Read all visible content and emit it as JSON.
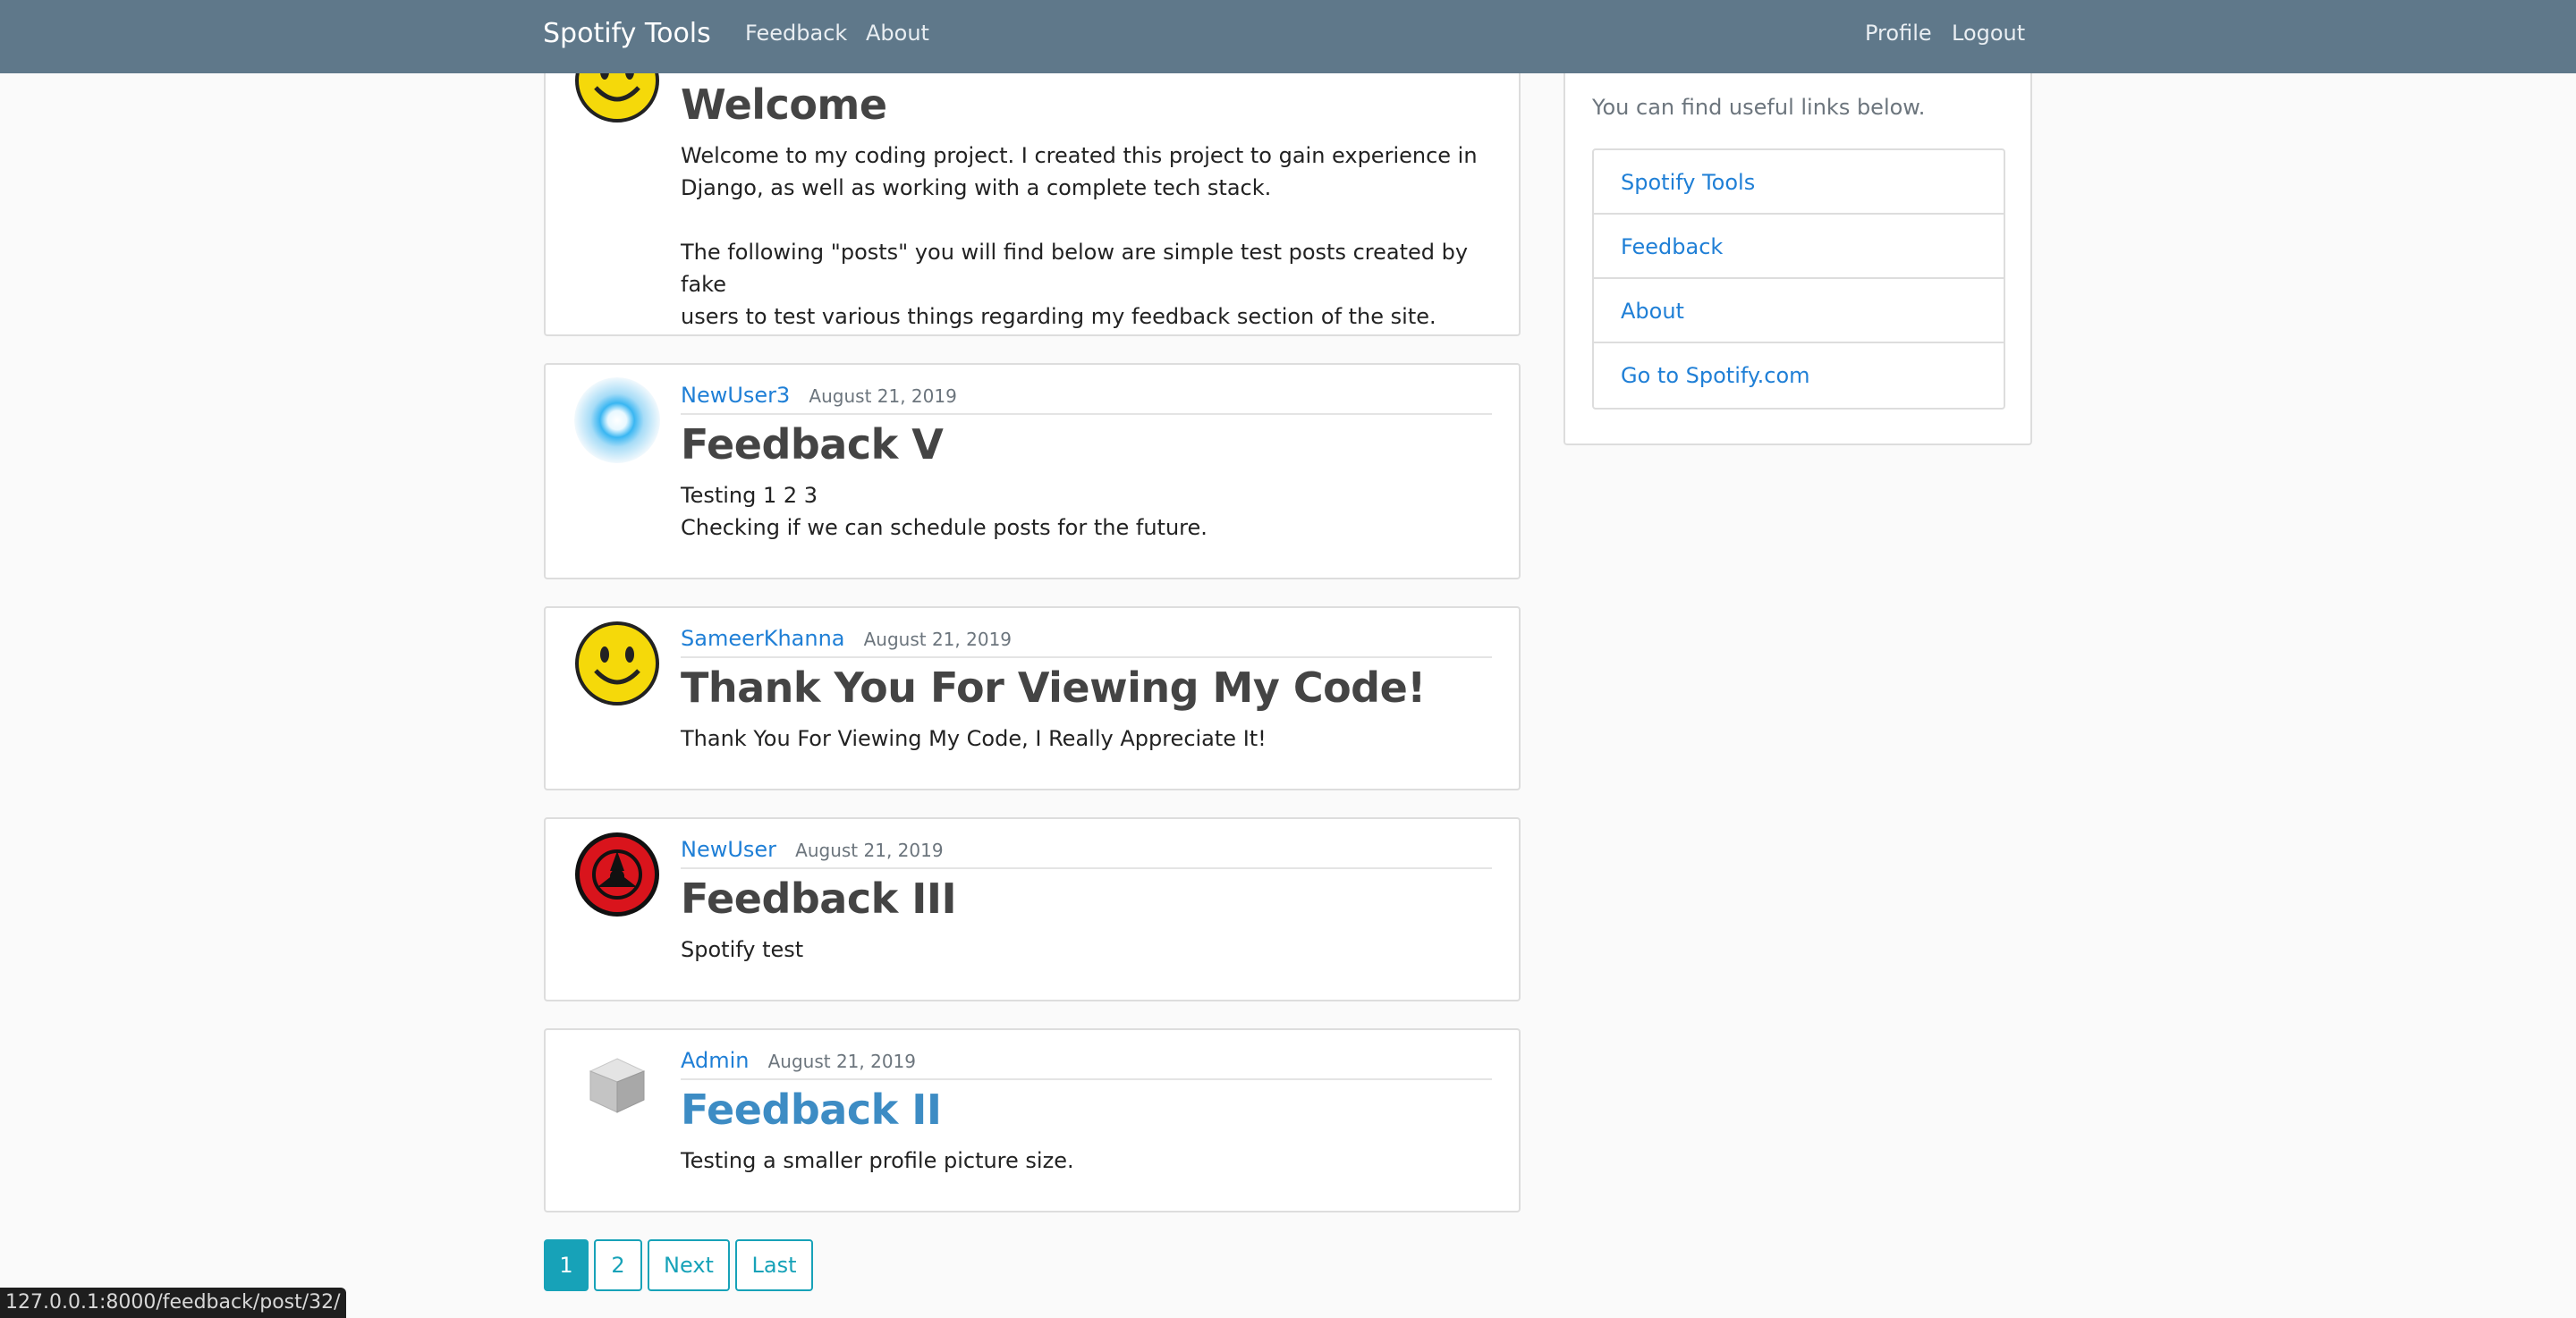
{
  "navbar": {
    "brand": "Spotify Tools",
    "links": [
      "Feedback",
      "About"
    ],
    "right_links": [
      "Profile",
      "Logout"
    ]
  },
  "posts": [
    {
      "author": "",
      "date": "",
      "avatar": "smiley-avatar",
      "title": "Welcome",
      "body": [
        "Welcome to my coding project. I created this project to gain experience in",
        "Django, as well as working with a complete tech stack.",
        "",
        "The following \"posts\" you will find below are simple test posts created by fake",
        "users to test various things regarding my feedback section of the site."
      ]
    },
    {
      "author": "NewUser3",
      "date": "August 21, 2019",
      "avatar": "blue-orb-avatar",
      "title": "Feedback V",
      "body": [
        "Testing 1 2 3",
        "Checking if we can schedule posts for the future."
      ]
    },
    {
      "author": "SameerKhanna",
      "date": "August 21, 2019",
      "avatar": "smiley-avatar",
      "title": "Thank You For Viewing My Code!",
      "body": [
        "Thank You For Viewing My Code, I Really Appreciate It!"
      ]
    },
    {
      "author": "NewUser",
      "date": "August 21, 2019",
      "avatar": "red-emblem-avatar",
      "title": "Feedback III",
      "body": [
        "Spotify test"
      ]
    },
    {
      "author": "Admin",
      "date": "August 21, 2019",
      "avatar": "cube-avatar",
      "title": "Feedback II",
      "body": [
        "Testing a smaller profile picture size."
      ]
    }
  ],
  "sidebar": {
    "intro": "You can find useful links below.",
    "links": [
      "Spotify Tools",
      "Feedback",
      "About",
      "Go to Spotify.com"
    ]
  },
  "pagination": {
    "buttons": [
      "1",
      "2",
      "Next",
      "Last"
    ],
    "active": "1"
  },
  "status_bar": {
    "url": "127.0.0.1:8000/feedback/post/32/"
  },
  "colors": {
    "navbar": "#5f788a",
    "link": "#1f7fd6",
    "pagination": "#17a2b8",
    "title_link": "#3d8cc4"
  }
}
